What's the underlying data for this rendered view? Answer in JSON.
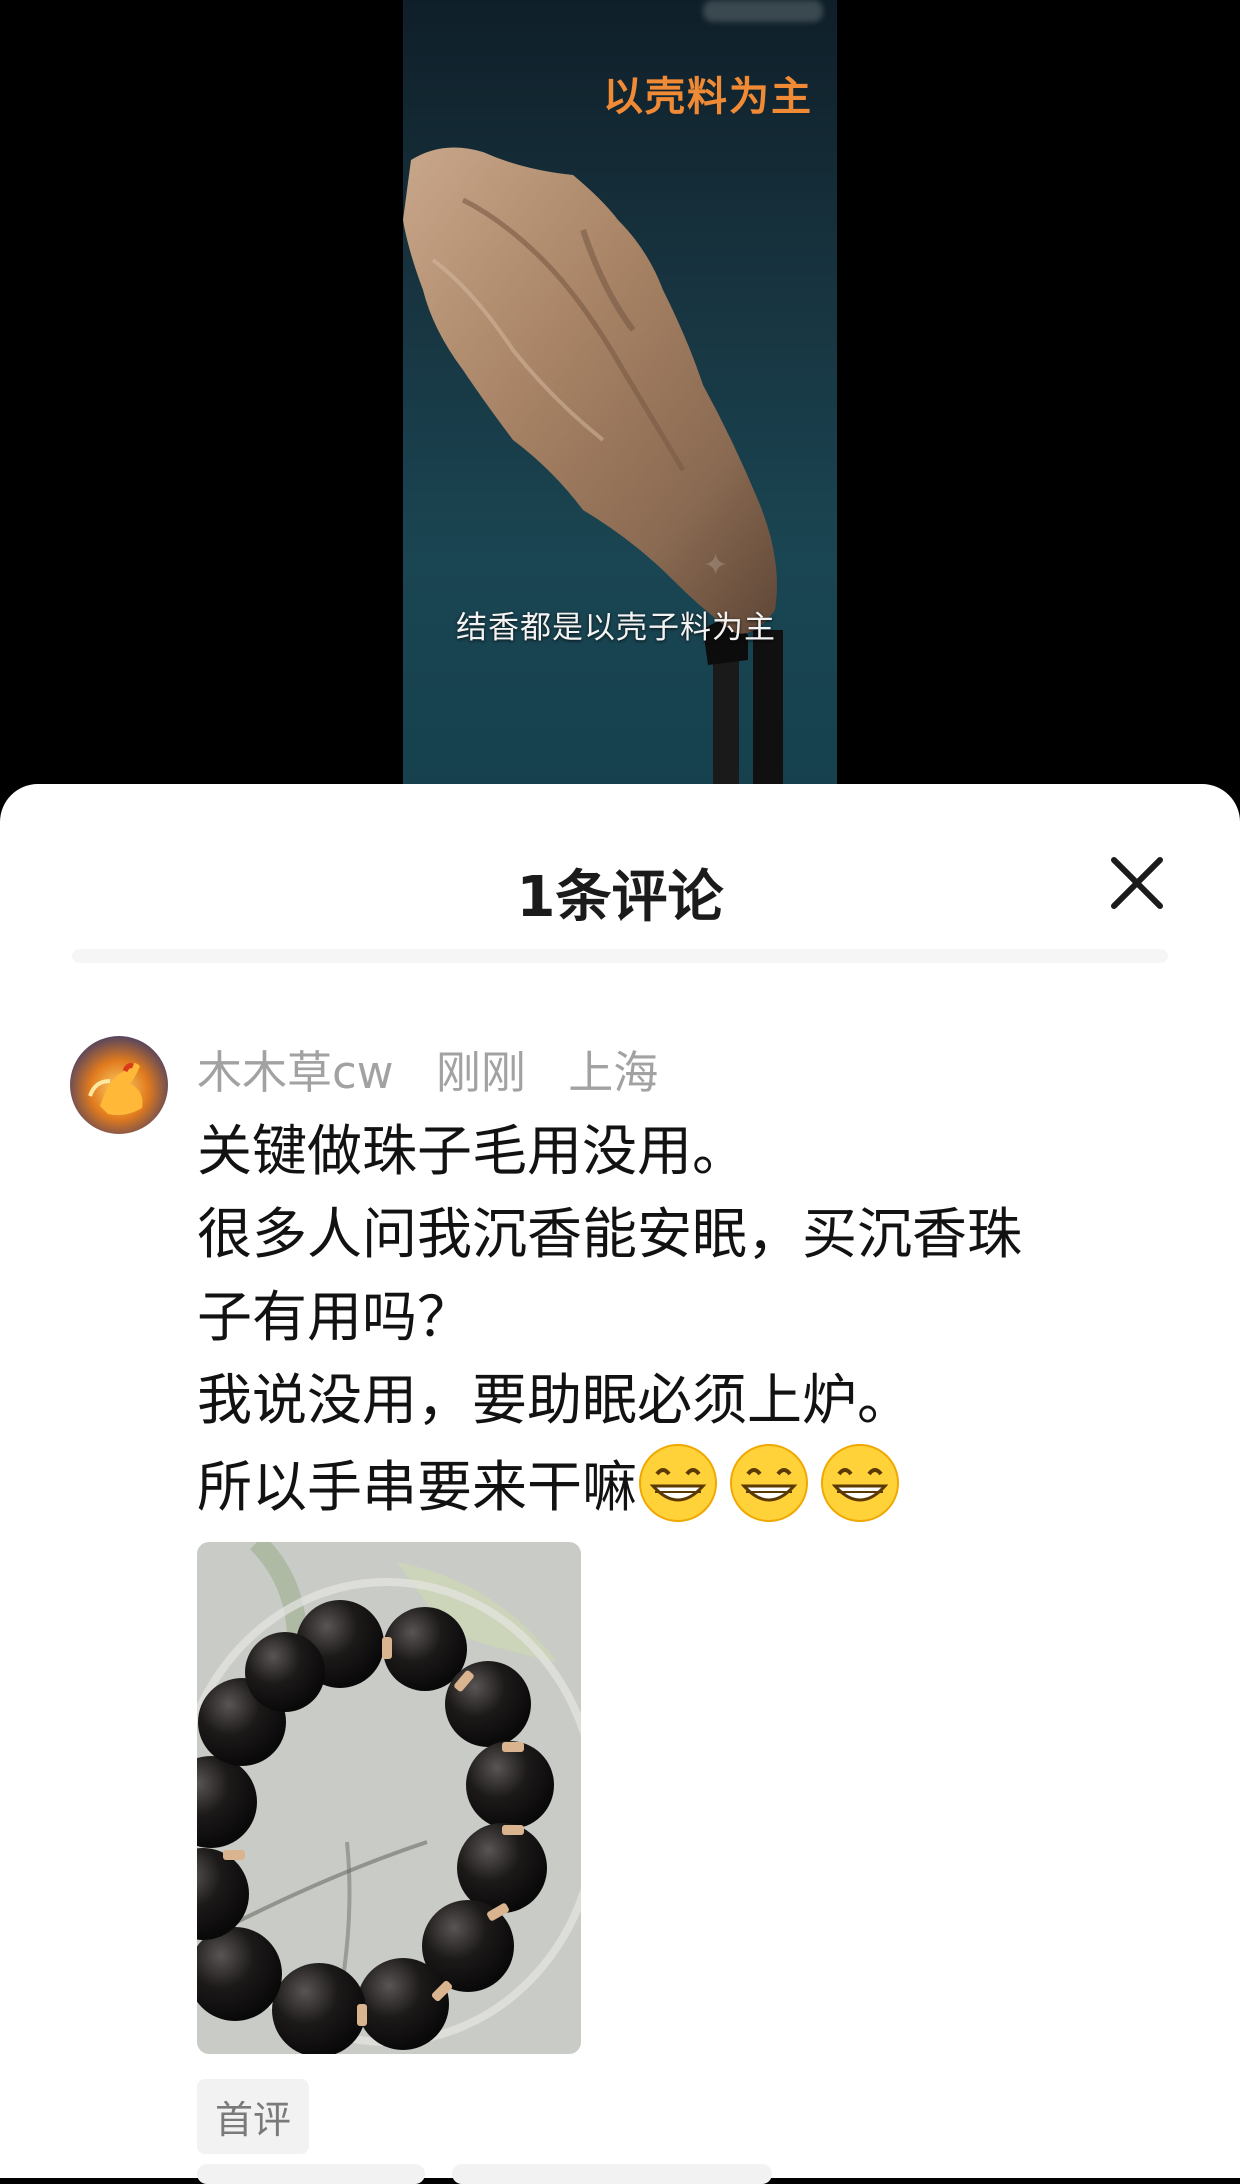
{
  "video": {
    "title": "以壳料为主",
    "subtitle": "结香都是以壳子料为主"
  },
  "sheet": {
    "title": "1条评论",
    "close_icon": "close-icon"
  },
  "comment": {
    "username": "木木草cw",
    "time": "刚刚",
    "location": "上海",
    "lines": [
      "关键做珠子毛用没用。",
      "很多人问我沉香能安眠，买沉香珠",
      "子有用吗？",
      "我说没用，要助眠必须上炉。",
      "所以手串要来干嘛"
    ],
    "emojis": [
      "grinning-face-emoji",
      "grinning-face-emoji",
      "grinning-face-emoji"
    ],
    "image_description_icon": "bead-bracelet-photo",
    "badge": "首评"
  },
  "colors": {
    "title_orange": "#f08a35",
    "meta_gray": "#a2a2a2",
    "text": "#121212",
    "sheet_bg": "#ffffff"
  }
}
